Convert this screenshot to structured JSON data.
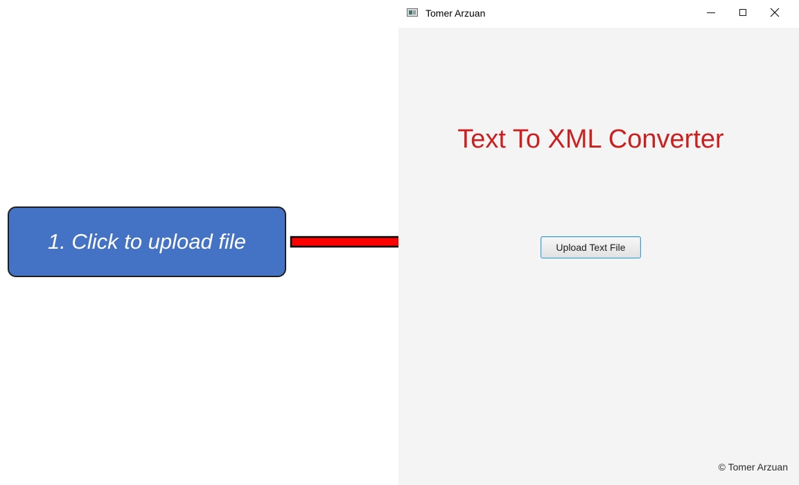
{
  "window": {
    "title": "Tomer Arzuan",
    "controls": {
      "minimize": "minimize-icon",
      "maximize": "maximize-icon",
      "close": "close-icon"
    }
  },
  "app": {
    "heading": "Text To XML Converter",
    "upload_button_label": "Upload Text File",
    "copyright": "© Tomer Arzuan"
  },
  "annotation": {
    "callout_text": "1. Click to upload file",
    "callout_color": "#4472C4",
    "arrow_color": "#FF0000"
  },
  "colors": {
    "heading": "#CC2020",
    "window_background": "#F4F4F4",
    "button_focus_border": "#3A9AD9"
  }
}
